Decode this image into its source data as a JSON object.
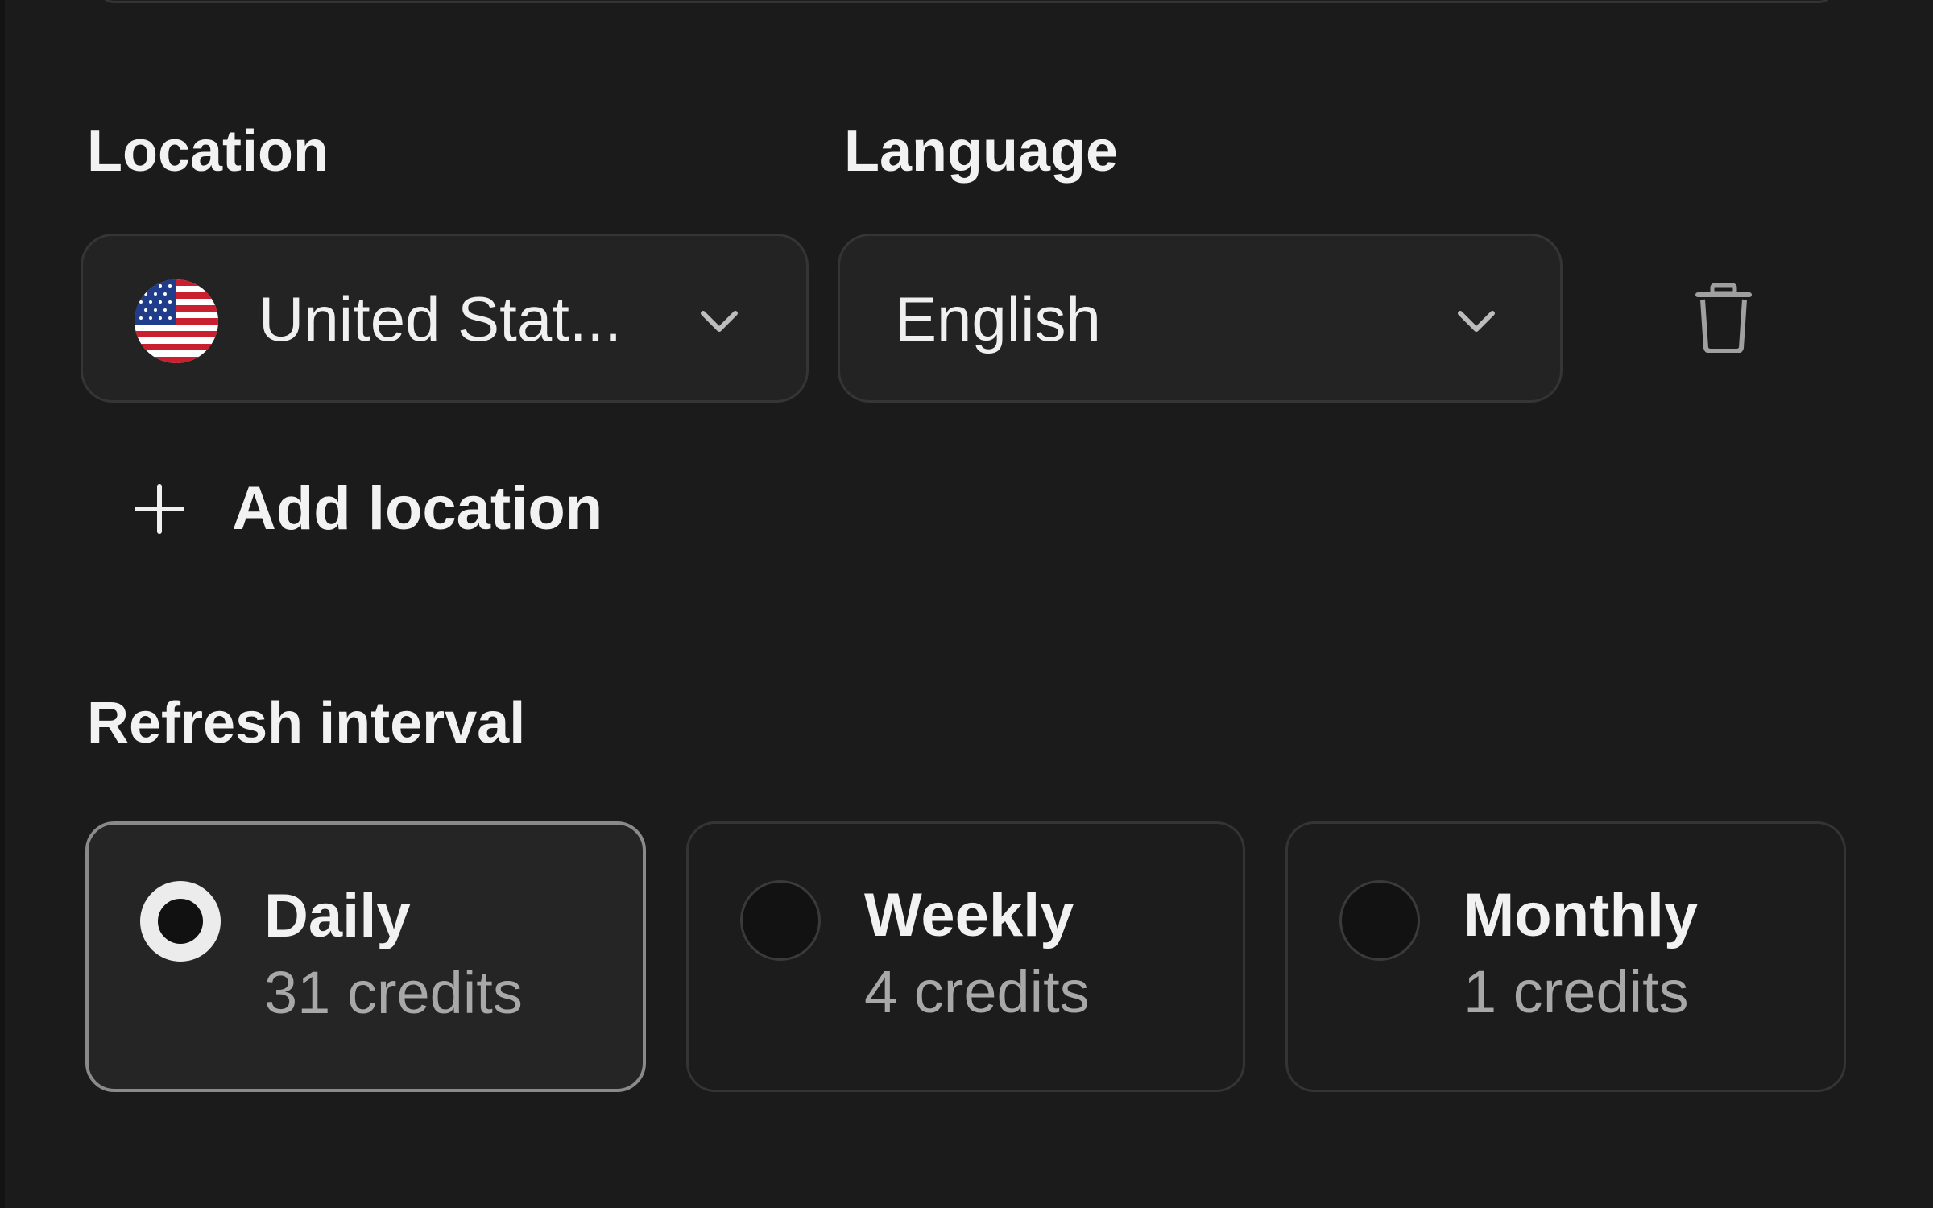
{
  "location": {
    "label": "Location",
    "selected": "United Stat...",
    "flag_icon": "us-flag-icon"
  },
  "language": {
    "label": "Language",
    "selected": "English"
  },
  "actions": {
    "add_location_label": "Add location",
    "delete_icon": "trash-icon"
  },
  "refresh": {
    "label": "Refresh interval",
    "selected": "Daily",
    "options": [
      {
        "title": "Daily",
        "credits": "31 credits",
        "selected": true
      },
      {
        "title": "Weekly",
        "credits": "4 credits",
        "selected": false
      },
      {
        "title": "Monthly",
        "credits": "1 credits",
        "selected": false
      }
    ]
  },
  "colors": {
    "background": "#1b1b1b",
    "field": "#232323",
    "border": "#353535",
    "selected_border": "#8a8a8a",
    "text": "#f2f2f2",
    "muted_text": "#a8a8a8"
  }
}
